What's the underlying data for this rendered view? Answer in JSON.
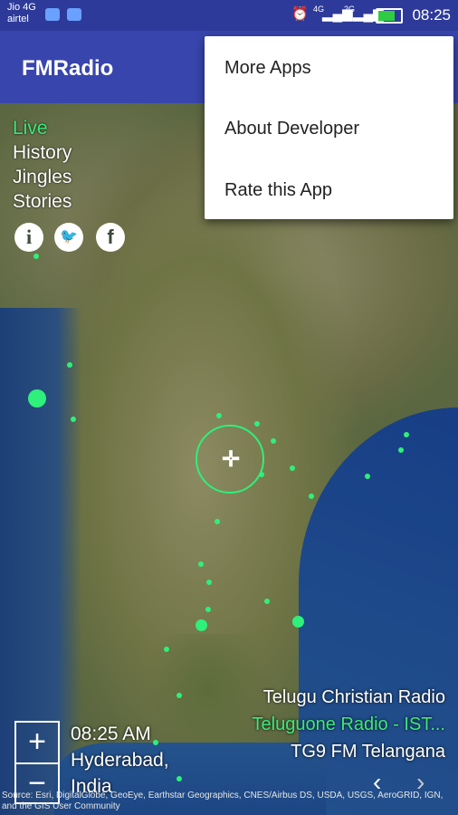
{
  "status_bar": {
    "carrier": "Jio 4G",
    "carrier2": "airtel",
    "network1": "4G",
    "network2": "2G",
    "time": "08:25"
  },
  "app_bar": {
    "title": "FMRadio"
  },
  "menu": {
    "items": [
      "More Apps",
      "About Developer",
      "Rate this App"
    ]
  },
  "nav": {
    "items": [
      {
        "label": "Live",
        "active": true
      },
      {
        "label": "History",
        "active": false
      },
      {
        "label": "Jingles",
        "active": false
      },
      {
        "label": "Stories",
        "active": false
      }
    ],
    "social": [
      "info-icon",
      "twitter-icon",
      "facebook-icon"
    ]
  },
  "stations": {
    "items": [
      "Telugu Christian Radio",
      "Teluguone Radio - IST...",
      "TG9 FM Telangana"
    ],
    "current_index": 1
  },
  "location": {
    "time": "08:25 AM",
    "city": "Hyderabad,",
    "country": "India"
  },
  "zoom": {
    "plus": "+",
    "minus": "−"
  },
  "attribution": "Source: Esri, DigitalGlobe, GeoEye, Earthstar Geographics, CNES/Airbus DS, USDA, USGS, AeroGRID, IGN, and the GIS User Community",
  "colors": {
    "accent": "#2ef07a",
    "app_bar": "#3845ad",
    "status_bar": "#2e3a9a"
  }
}
